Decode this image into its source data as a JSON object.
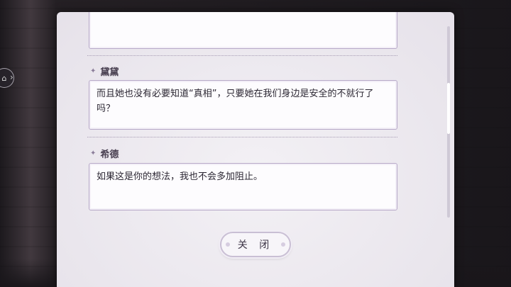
{
  "dialog_log": {
    "entries": [
      {
        "speaker": "",
        "text": ""
      },
      {
        "speaker": "黛黛",
        "text": "而且她也没有必要知道“真相”，只要她在我们身边是安全的不就行了吗？"
      },
      {
        "speaker": "希德",
        "text": "如果这是你的想法，我也不会多加阻止。"
      }
    ],
    "close_label": "关 闭",
    "side_button_icon": "menu-icon"
  }
}
